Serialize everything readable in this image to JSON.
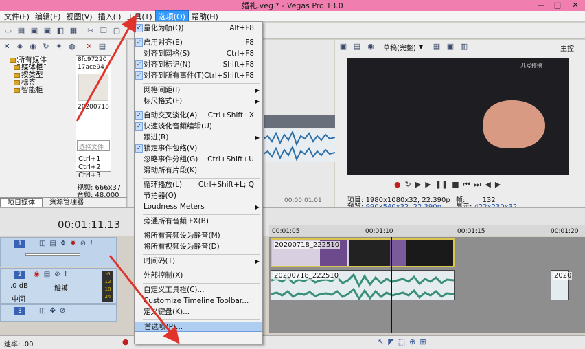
{
  "window": {
    "title": "婚礼.veg * - Vegas Pro 13.0",
    "minimize": "—",
    "maximize": "□",
    "close": "✕"
  },
  "menubar": [
    {
      "label": "文件(F)",
      "active": false
    },
    {
      "label": "编辑(E)",
      "active": false
    },
    {
      "label": "视图(V)",
      "active": false
    },
    {
      "label": "插入(I)",
      "active": false
    },
    {
      "label": "工具(T)",
      "active": false
    },
    {
      "label": "选项(O)",
      "active": true
    },
    {
      "label": "帮助(H)",
      "active": false
    }
  ],
  "media_tree": {
    "items": [
      "所有媒体",
      "媒体柜",
      "按类型",
      "标签",
      "智能柜"
    ],
    "tabs": [
      "项目媒体",
      "资源管理器"
    ],
    "thumb_text": [
      "8fc97220",
      "17ace94"
    ],
    "thumb_caption": "20200718",
    "search_placeholder": "选择文件",
    "shortcuts": [
      "Ctrl+1",
      "Ctrl+2",
      "Ctrl+3"
    ],
    "video_info": "视频: 666x37",
    "audio_info": "音频: 48,000"
  },
  "preview": {
    "quality": "草稿(完整)",
    "watermark": "几号搭搞",
    "project_label": "项目:",
    "project_value": "1980x1080x32, 22.390p",
    "preview_label": "预览:",
    "preview_value": "990x540x32, 22.390p",
    "frame_label": "帧:",
    "frame_value": "132",
    "display_label": "显示:",
    "display_value": "422x230x32",
    "right_label": "主控"
  },
  "mid": {
    "timecode": "00:00:01.01"
  },
  "timeline": {
    "timecode": "00:01:11.13",
    "ruler": [
      "00:01:05",
      "00:01:10",
      "00:01:15",
      "00:01:20"
    ],
    "tracks": [
      {
        "num": "1"
      },
      {
        "num": "2",
        "db": ".0 dB",
        "pan": "中间",
        "mode": "触摸"
      },
      {
        "num": "3"
      }
    ],
    "clips": [
      {
        "name": "20200718_222510"
      },
      {
        "name": "20200718_222510"
      },
      {
        "name": "2020"
      }
    ],
    "rate": "速率: .00",
    "meter": [
      "-6",
      "12",
      "18",
      "24"
    ]
  },
  "options_menu": [
    {
      "label": "量化为帧(Q)",
      "shortcut": "Alt+F8",
      "checked": true
    },
    {
      "sep": true
    },
    {
      "label": "启用对齐(E)",
      "shortcut": "F8",
      "checked": true
    },
    {
      "label": "对齐到网格(S)",
      "shortcut": "Ctrl+F8",
      "checked": false
    },
    {
      "label": "对齐到标记(N)",
      "shortcut": "Shift+F8",
      "checked": true
    },
    {
      "label": "对齐到所有事件(T)",
      "shortcut": "Ctrl+Shift+F8",
      "checked": true
    },
    {
      "sep": true
    },
    {
      "label": "网格间距(I)",
      "shortcut": "",
      "submenu": true
    },
    {
      "label": "标尺格式(F)",
      "shortcut": "",
      "submenu": true
    },
    {
      "sep": true
    },
    {
      "label": "自动交叉淡化(A)",
      "shortcut": "Ctrl+Shift+X",
      "checked": true
    },
    {
      "label": "快速淡化音频编辑(U)",
      "shortcut": "",
      "checked": true
    },
    {
      "label": "跟进(R)",
      "shortcut": "",
      "submenu": true
    },
    {
      "label": "锁定事件包络(V)",
      "shortcut": "",
      "checked": true
    },
    {
      "label": "忽略事件分组(G)",
      "shortcut": "Ctrl+Shift+U",
      "checked": false
    },
    {
      "label": "滑动所有片段(K)",
      "shortcut": "",
      "checked": false
    },
    {
      "sep": true
    },
    {
      "label": "循环播放(L)",
      "shortcut": "Ctrl+Shift+L; Q",
      "checked": false
    },
    {
      "label": "节拍器(O)",
      "shortcut": "",
      "checked": false
    },
    {
      "label": "Loudness Meters",
      "shortcut": "",
      "submenu": true
    },
    {
      "sep": true
    },
    {
      "label": "旁通所有音频 FX(B)",
      "shortcut": "",
      "checked": false
    },
    {
      "sep": true
    },
    {
      "label": "将所有音频设为静音(M)",
      "shortcut": "",
      "checked": false
    },
    {
      "label": "将所有视频设为静音(D)",
      "shortcut": "",
      "checked": false
    },
    {
      "sep": true
    },
    {
      "label": "时间码(T)",
      "shortcut": "",
      "submenu": true
    },
    {
      "sep": true
    },
    {
      "label": "外部控制(X)",
      "shortcut": "",
      "checked": false
    },
    {
      "sep": true
    },
    {
      "label": "自定义工具栏(C)...",
      "shortcut": "",
      "checked": false
    },
    {
      "label": "Customize Timeline Toolbar...",
      "shortcut": "",
      "checked": false
    },
    {
      "label": "定义键盘(K)...",
      "shortcut": "",
      "checked": false
    },
    {
      "sep": true
    },
    {
      "label": "首选项(P)...",
      "shortcut": "",
      "checked": false,
      "highlight": true
    }
  ],
  "colors": {
    "title_bar": "#f07fb0",
    "menu_active": "#3399ff",
    "annotation_arrow": "#e0332b",
    "clip_video": "#d9c64e",
    "clip_audio_wave": "#3a8f7b"
  }
}
